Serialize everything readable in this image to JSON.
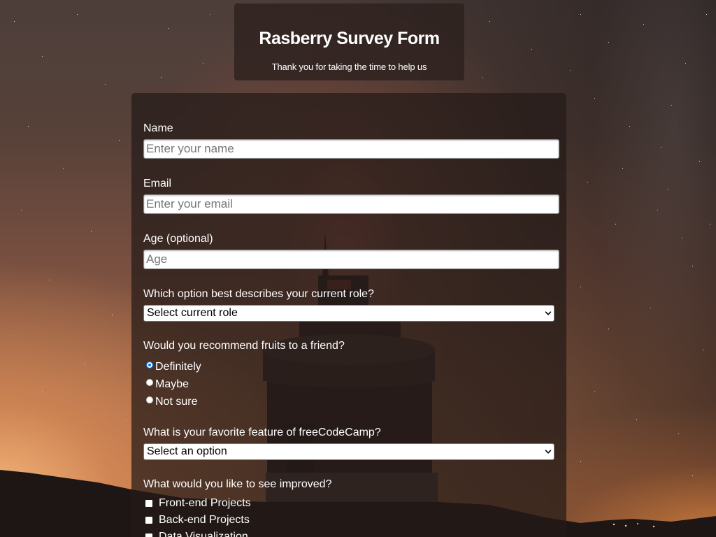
{
  "header": {
    "title": "Rasberry Survey Form",
    "description": "Thank you for taking the time to help us"
  },
  "form": {
    "name": {
      "label": "Name",
      "placeholder": "Enter your name"
    },
    "email": {
      "label": "Email",
      "placeholder": "Enter your email"
    },
    "age": {
      "label": "Age (optional)",
      "placeholder": "Age"
    },
    "role": {
      "label": "Which option best describes your current role?",
      "selected": "Select current role",
      "icon": "chevron-down-icon"
    },
    "recommend": {
      "label": "Would you recommend fruits to a friend?",
      "options": [
        {
          "label": "Definitely",
          "checked": true
        },
        {
          "label": "Maybe",
          "checked": false
        },
        {
          "label": "Not sure",
          "checked": false
        }
      ]
    },
    "feature": {
      "label": "What is your favorite feature of freeCodeCamp?",
      "selected": "Select an option",
      "icon": "chevron-down-icon"
    },
    "improve": {
      "label": "What would you like to see improved?",
      "options": [
        {
          "label": "Front-end Projects",
          "checked": false
        },
        {
          "label": "Back-end Projects",
          "checked": false
        },
        {
          "label": "Data Visualization",
          "checked": false
        }
      ]
    }
  },
  "colors": {
    "text": "#ffffff",
    "accent": "#0075ff",
    "input_background": "#ffffff",
    "placeholder": "#767676"
  }
}
